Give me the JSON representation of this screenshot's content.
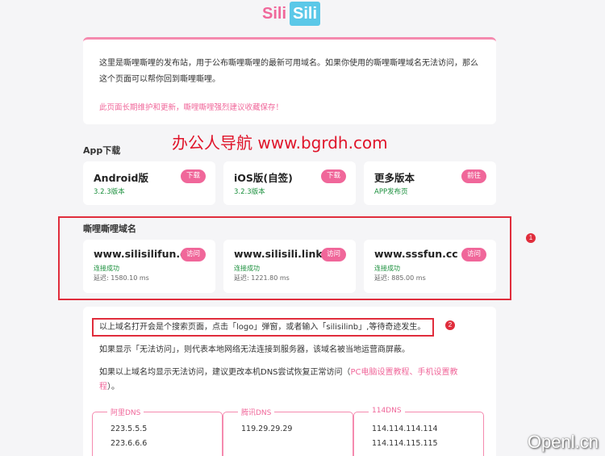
{
  "logo": {
    "part_a": "Sili",
    "part_b": "Sili"
  },
  "intro": {
    "text": "这里是嘶哩嘶哩的发布站，用于公布嘶哩嘶哩的最新可用域名。如果你使用的嘶哩嘶哩域名无法访问，那么这个页面可以帮你回到嘶哩嘶哩。",
    "warning": "此页面长期维护和更新，嘶哩嘶哩强烈建议收藏保存！"
  },
  "watermark_overlay": "办公人导航 www.bgrdh.com",
  "app_section": {
    "title": "App下载",
    "tiles": [
      {
        "name": "Android版",
        "version": "3.2.3版本",
        "button": "下载"
      },
      {
        "name": "iOS版(自签)",
        "version": "3.2.3版本",
        "button": "下载"
      },
      {
        "name": "更多版本",
        "version": "APP发布页",
        "button": "前往"
      }
    ]
  },
  "domain_section": {
    "title": "嘶哩嘶哩域名",
    "tiles": [
      {
        "domain": "www.silisilifun.com",
        "status": "连接成功",
        "latency": "延迟: 1580.10 ms",
        "button": "访问"
      },
      {
        "domain": "www.silisili.link",
        "status": "连接成功",
        "latency": "延迟: 1221.80 ms",
        "button": "访问"
      },
      {
        "domain": "www.sssfun.cc",
        "status": "连接成功",
        "latency": "延迟: 885.00 ms",
        "button": "访问"
      }
    ]
  },
  "annotations": {
    "badge1": "1",
    "badge2": "2"
  },
  "info": {
    "line1": "以上域名打开会是个搜索页面，点击「logo」弹窗，或者输入「silisilinb」,等待奇迹发生。",
    "line2": "如果显示「无法访问」，则代表本地网络无法连接到服务器，该域名被当地运营商屏蔽。",
    "line3_pre": "如果以上域名均显示无法访问，建议更改本机DNS尝试恢复正常访问（",
    "link_pc": "PC电脑设置教程",
    "sep": "、",
    "link_mobile": "手机设置教",
    "line4_link": "程",
    "line4_post": "）。"
  },
  "dns": [
    {
      "label": "阿里DNS",
      "ips": [
        "223.5.5.5",
        "223.6.6.6"
      ]
    },
    {
      "label": "腾讯DNS",
      "ips": [
        "119.29.29.29"
      ]
    },
    {
      "label": "114DNS",
      "ips": [
        "114.114.114.114",
        "114.114.115.115"
      ]
    }
  ],
  "corner_watermark": "Openl.cn"
}
